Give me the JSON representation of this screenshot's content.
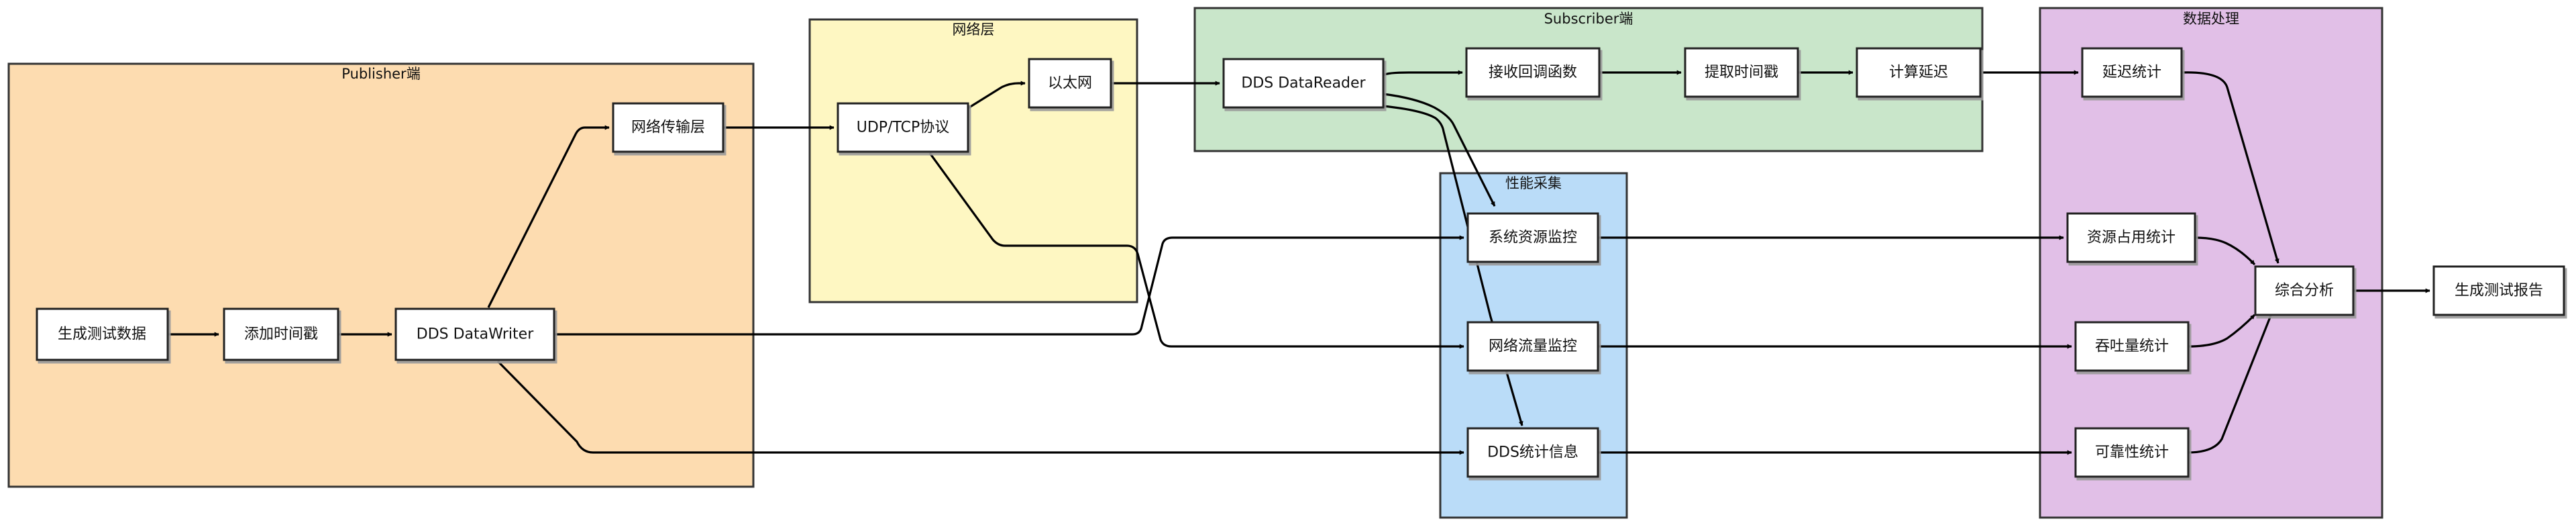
{
  "groups": {
    "publisher": "Publisher端",
    "network": "网络层",
    "subscriber": "Subscriber端",
    "perf": "性能采集",
    "data": "数据处理"
  },
  "nodes": {
    "gen_data": "生成测试数据",
    "add_ts": "添加时间戳",
    "writer": "DDS DataWriter",
    "net_transport": "网络传输层",
    "udp_tcp": "UDP/TCP协议",
    "ethernet": "以太网",
    "reader": "DDS DataReader",
    "recv_cb": "接收回调函数",
    "extract_ts": "提取时间戳",
    "calc_delay": "计算延迟",
    "sys_res": "系统资源监控",
    "net_flow": "网络流量监控",
    "dds_stats": "DDS统计信息",
    "delay_stats": "延迟统计",
    "res_stats": "资源占用统计",
    "throughput": "吞吐量统计",
    "reliability": "可靠性统计",
    "analysis": "综合分析",
    "report": "生成测试报告"
  },
  "colors": {
    "publisher": "#fddcb0",
    "network": "#fef7c2",
    "subscriber": "#c9e6ca",
    "perf": "#badcf8",
    "data": "#e1bfe7"
  }
}
